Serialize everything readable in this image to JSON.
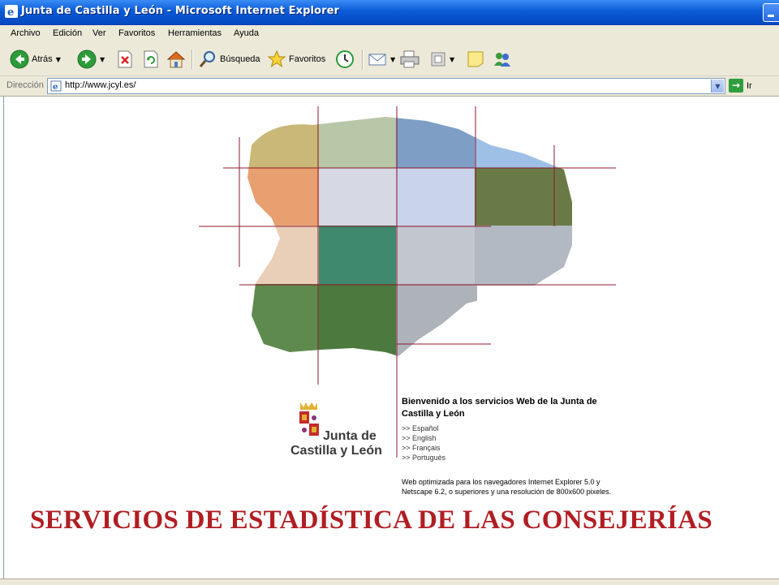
{
  "window": {
    "title": "Junta de Castilla y León - Microsoft Internet Explorer"
  },
  "menu": [
    "Archivo",
    "Edición",
    "Ver",
    "Favoritos",
    "Herramientas",
    "Ayuda"
  ],
  "toolbar": {
    "back_label": "Atrás",
    "search_label": "Búsqueda",
    "favorites_label": "Favoritos"
  },
  "address": {
    "label": "Dirección",
    "url": "http://www.jcyl.es/",
    "go_label": "Ir"
  },
  "page": {
    "welcome": "Bienvenido a los servicios Web de la Junta de Castilla y León",
    "languages": [
      ">> Español",
      ">> English",
      ">> Français",
      ">> Portuguès"
    ],
    "browser_note": "Web optimizada para los navegadores Internet Explorer 5.0 y Netscape 6.2, o superiores y una resolución de 800x600 pixeles.",
    "logo_line1": "Junta de",
    "logo_line2": "Castilla y León",
    "banner": "SERVICIOS DE ESTADÍSTICA DE LAS CONSEJERÍAS"
  },
  "colors": {
    "title_bar": "#0a5bd6",
    "chrome": "#ece9d8",
    "grid_line": "#8b1a2b",
    "banner": "#b01e23"
  }
}
